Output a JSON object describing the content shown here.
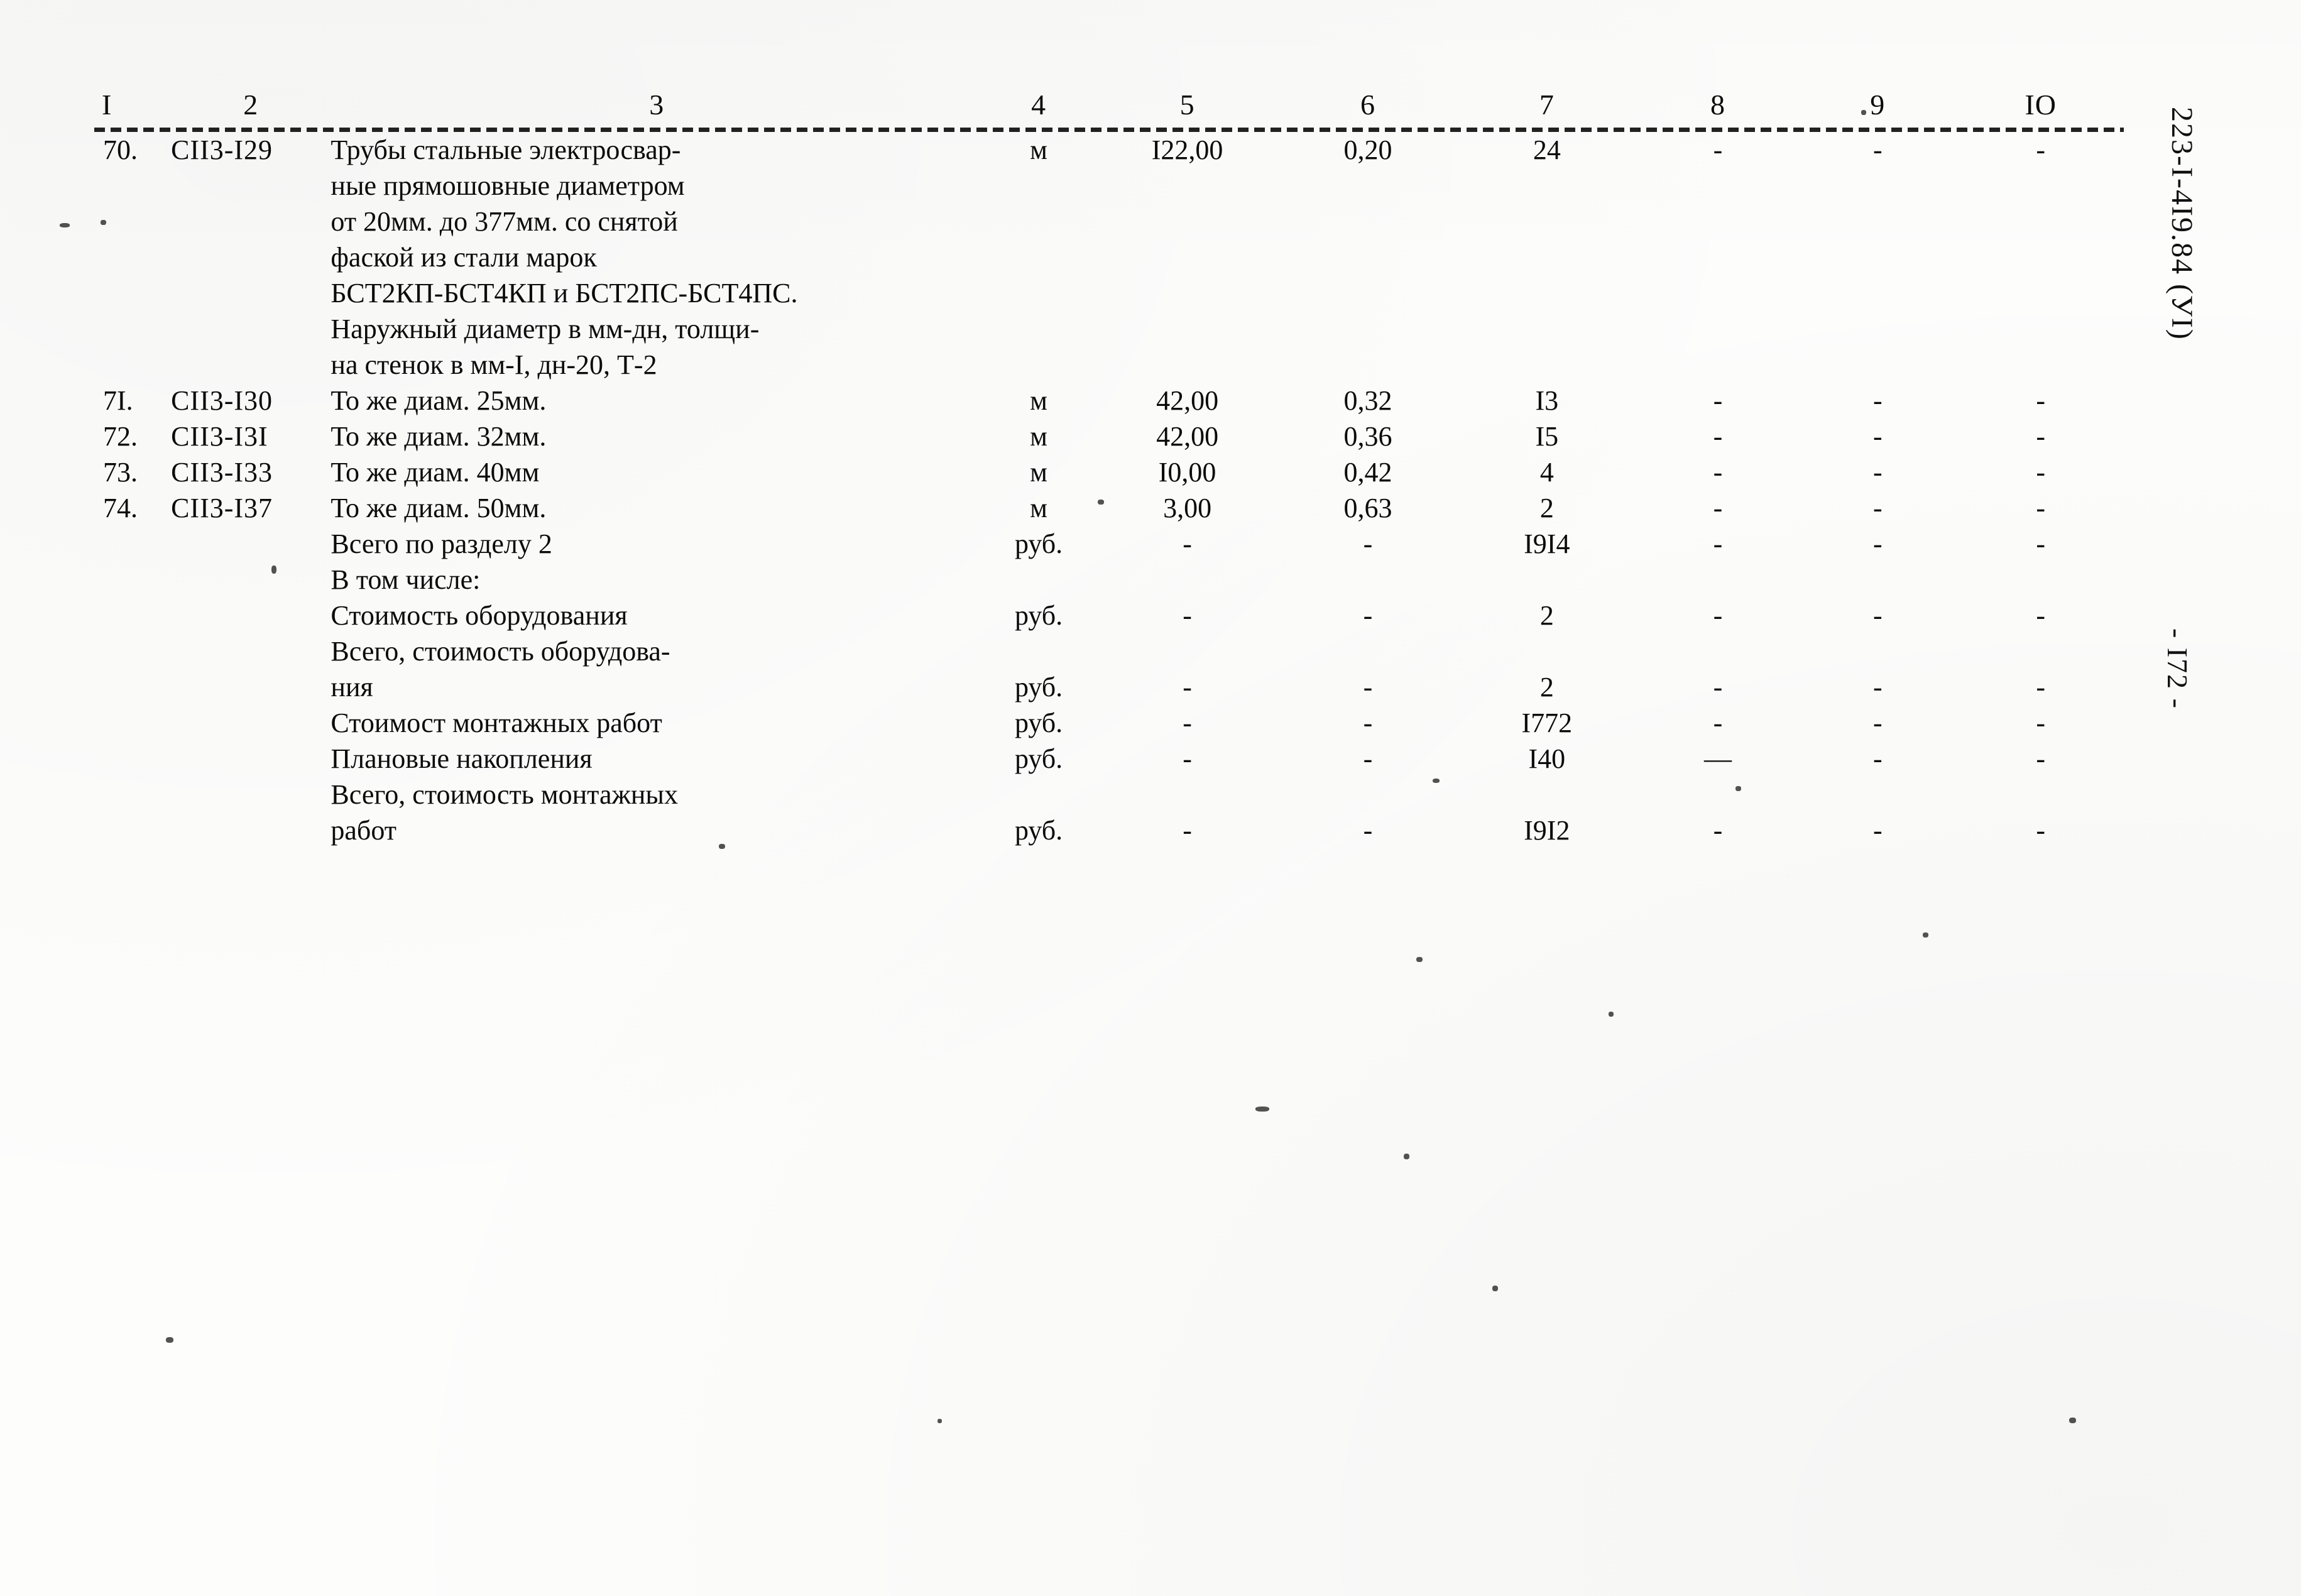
{
  "document": {
    "code_vertical": "223-I-4I9.84 (УI)",
    "page_marker": "- I72 -"
  },
  "table": {
    "column_headers": [
      "I",
      "2",
      "3",
      "4",
      "5",
      "6",
      "7",
      "8",
      "9",
      "IO"
    ],
    "rows": [
      {
        "num": "70.",
        "code": "СII3-I29",
        "desc_lines": [
          "Трубы стальные электросвар-",
          "ные прямошовные диаметром",
          "от 20мм. до 377мм. со снятой",
          "фаской из стали марок",
          "БСТ2КП-БСТ4КП и БСТ2ПС-БСТ4ПС.",
          "Наружный диаметр в мм-дн, толщи-",
          "на стенок в мм-I, дн-20, Т-2"
        ],
        "unit": "м",
        "qty": "I22,00",
        "weight": "0,20",
        "sum": "24",
        "c8": "-",
        "c9": "-",
        "c10": "-"
      },
      {
        "num": "7I.",
        "code": "СII3-I30",
        "desc_lines": [
          "То же диам. 25мм."
        ],
        "unit": "м",
        "qty": "42,00",
        "weight": "0,32",
        "sum": "I3",
        "c8": "-",
        "c9": "-",
        "c10": "-"
      },
      {
        "num": "72.",
        "code": "СII3-I3I",
        "desc_lines": [
          "То же диам. 32мм."
        ],
        "unit": "м",
        "qty": "42,00",
        "weight": "0,36",
        "sum": "I5",
        "c8": "-",
        "c9": "-",
        "c10": "-"
      },
      {
        "num": "73.",
        "code": "СII3-I33",
        "desc_lines": [
          "То же диам. 40мм"
        ],
        "unit": "м",
        "qty": "I0,00",
        "weight": "0,42",
        "sum": "4",
        "c8": "-",
        "c9": "-",
        "c10": "-"
      },
      {
        "num": "74.",
        "code": "СII3-I37",
        "desc_lines": [
          "То же диам. 50мм."
        ],
        "unit": "м",
        "qty": "3,00",
        "weight": "0,63",
        "sum": "2",
        "c8": "-",
        "c9": "-",
        "c10": "-"
      }
    ],
    "summary_rows": [
      {
        "num": "",
        "code": "",
        "desc_lines": [
          "Всего по разделу 2"
        ],
        "unit": "руб.",
        "qty": "-",
        "weight": "-",
        "sum": "I9I4",
        "c8": "-",
        "c9": "-",
        "c10": "-"
      },
      {
        "num": "",
        "code": "",
        "desc_lines": [
          "В том числе:"
        ],
        "unit": "",
        "qty": "",
        "weight": "",
        "sum": "",
        "c8": "",
        "c9": "",
        "c10": ""
      },
      {
        "num": "",
        "code": "",
        "desc_lines": [
          "Стоимость оборудования"
        ],
        "unit": "руб.",
        "qty": "-",
        "weight": "-",
        "sum": "2",
        "c8": "-",
        "c9": "-",
        "c10": "-"
      },
      {
        "num": "",
        "code": "",
        "desc_lines": [
          "Всего, стоимость оборудова-",
          "ния"
        ],
        "unit": "руб.",
        "qty": "-",
        "weight": "-",
        "sum": "2",
        "c8": "-",
        "c9": "-",
        "c10": "-"
      },
      {
        "num": "",
        "code": "",
        "desc_lines": [
          "Стоимост монтажных работ"
        ],
        "unit": "руб.",
        "qty": "-",
        "weight": "-",
        "sum": "I772",
        "c8": "-",
        "c9": "-",
        "c10": "-"
      },
      {
        "num": "",
        "code": "",
        "desc_lines": [
          "Плановые накопления"
        ],
        "unit": "руб.",
        "qty": "-",
        "weight": "-",
        "sum": "I40",
        "c8": "—",
        "c9": "-",
        "c10": "-"
      },
      {
        "num": "",
        "code": "",
        "desc_lines": [
          "Всего, стоимость монтажных",
          "работ"
        ],
        "unit": "руб.",
        "qty": "-",
        "weight": "-",
        "sum": "I9I2",
        "c8": "-",
        "c9": "-",
        "c10": "-"
      }
    ]
  }
}
